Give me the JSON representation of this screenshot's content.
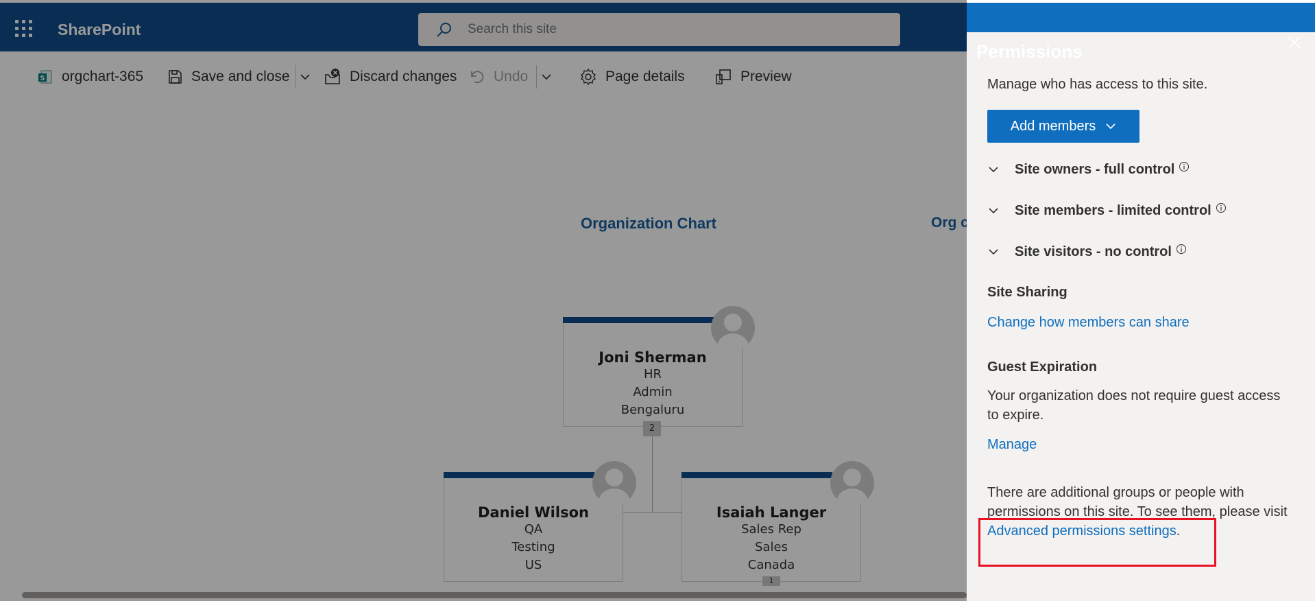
{
  "suitebar": {
    "app_name": "SharePoint",
    "search_placeholder": "Search this site"
  },
  "commandbar": {
    "page_name": "orgchart-365",
    "save_label": "Save and close",
    "discard_label": "Discard changes",
    "undo_label": "Undo",
    "page_details_label": "Page details",
    "preview_label": "Preview"
  },
  "canvas": {
    "chart_title": "Organization Chart",
    "chart_title_2": "Org c",
    "root": {
      "name": "Joni Sherman",
      "line1": "HR",
      "line2": "Admin",
      "line3": "Bengaluru",
      "count": "2"
    },
    "children": [
      {
        "name": "Daniel Wilson",
        "line1": "QA",
        "line2": "Testing",
        "line3": "US"
      },
      {
        "name": "Isaiah Langer",
        "line1": "Sales Rep",
        "line2": "Sales",
        "line3": "Canada",
        "count": "1"
      }
    ]
  },
  "panel": {
    "title": "Permissions",
    "description": "Manage who has access to this site.",
    "add_members_label": "Add members",
    "groups": [
      {
        "label": "Site owners - full control"
      },
      {
        "label": "Site members - limited control"
      },
      {
        "label": "Site visitors - no control"
      }
    ],
    "site_sharing_heading": "Site Sharing",
    "site_sharing_link": "Change how members can share",
    "guest_expiration_heading": "Guest Expiration",
    "guest_expiration_text_1": "Your organization does not require guest access",
    "guest_expiration_text_2": "to expire.",
    "manage_link": "Manage",
    "additional_text_1": "There are additional groups or people with",
    "additional_text_2": "permissions on this site. To see them, please visit",
    "advanced_link": "Advanced permissions settings",
    "advanced_suffix": "."
  },
  "colors": {
    "suitebar": "#0f4c8a",
    "panel_header": "#106ebe",
    "link": "#106ebe",
    "highlight": "#e81123"
  }
}
